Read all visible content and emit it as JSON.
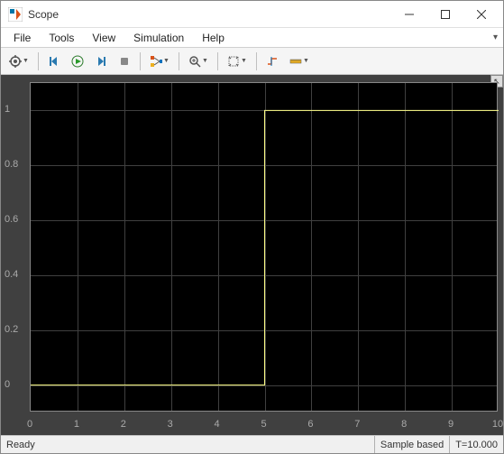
{
  "window": {
    "title": "Scope"
  },
  "menu": {
    "file": "File",
    "tools": "Tools",
    "view": "View",
    "simulation": "Simulation",
    "help": "Help"
  },
  "status": {
    "ready": "Ready",
    "sample": "Sample based",
    "time": "T=10.000"
  },
  "chart_data": {
    "type": "line",
    "x": [
      0,
      5,
      5,
      10
    ],
    "y": [
      0,
      0,
      1,
      1
    ],
    "xlabel": "",
    "ylabel": "",
    "xlim": [
      0,
      10
    ],
    "ylim": [
      -0.1,
      1.1
    ],
    "xticks": [
      0,
      1,
      2,
      3,
      4,
      5,
      6,
      7,
      8,
      9,
      10
    ],
    "yticks": [
      0,
      0.2,
      0.4,
      0.6,
      0.8,
      1
    ],
    "line_color": "#ffff88"
  }
}
